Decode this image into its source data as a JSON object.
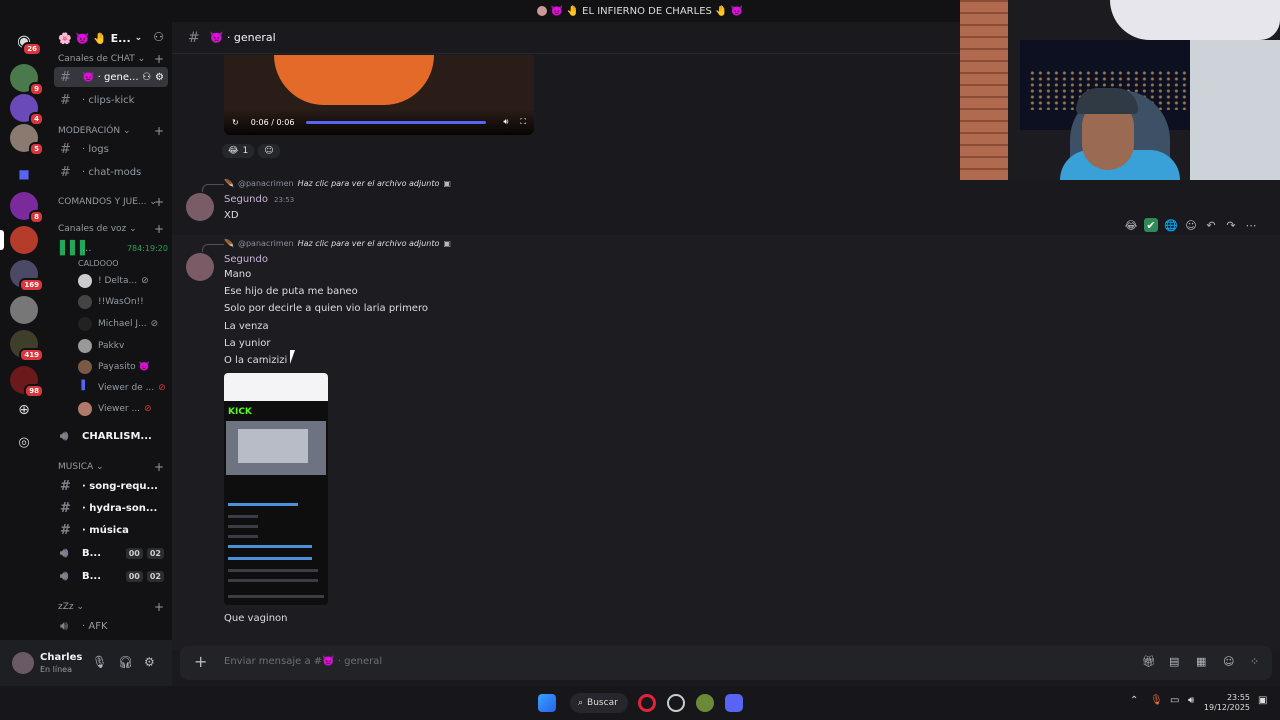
{
  "window": {
    "title": "👿 🤚 EL INFIERNO DE CHARLES 🤚 👿"
  },
  "servers": [
    {
      "badge": "26"
    },
    {
      "badge": "9"
    },
    {
      "badge": "4"
    },
    {
      "badge": "5"
    },
    {
      "badge": ""
    },
    {
      "badge": "8"
    },
    {
      "badge": ""
    },
    {
      "badge": "169"
    },
    {
      "badge": ""
    },
    {
      "badge": "419"
    },
    {
      "badge": "98"
    }
  ],
  "guild": {
    "name": "🌸 👿 🤚 E..."
  },
  "categories": {
    "chat": "Canales de CHAT",
    "mod": "MODERACIÓN",
    "cmds": "COMANDOS Y JUE...",
    "voice": "Canales de voz",
    "music": "MUSICA",
    "zzz": "zZz"
  },
  "channels": {
    "general": "👿 · gene...",
    "clips": "· clips-kick",
    "logs": "· logs",
    "chatmods": "· chat-mods",
    "voice_main": "...",
    "voice_main_time": "784:19:20",
    "charlism": "CHARLISM...",
    "song": "· song-requ...",
    "hydra": "· hydra-son...",
    "musica": "· música",
    "b1": "B...",
    "b2": "B...",
    "b1_a": "00",
    "b1_b": "02",
    "b2_a": "00",
    "b2_b": "02",
    "afk": "· AFK"
  },
  "voice_users": [
    "CALDOOO",
    "! Delta...",
    "!!WasOn!!",
    "Michael J...",
    "Pakkv",
    "Payasito 👿",
    "Viewer de ...",
    "Viewer ..."
  ],
  "user": {
    "name": "Charles",
    "status": "En línea"
  },
  "header": {
    "channel": "👿 · general"
  },
  "video": {
    "time": "0:06 / 0:06"
  },
  "reaction": {
    "count": "1"
  },
  "messages": [
    {
      "reply_user": "@panacrimen",
      "reply_text": "Haz clic para ver el archivo adjunto",
      "author": "Segundo",
      "time": "23:53",
      "lines": [
        "XD"
      ]
    },
    {
      "reply_user": "@panacrimen",
      "reply_text": "Haz clic para ver el archivo adjunto",
      "author": "Segundo",
      "lines": [
        "Mano",
        "Ese hijo de puta me baneo",
        "Solo por decirle a quien vio laria primero",
        "La venza",
        "La yunior",
        "O la camizizi"
      ],
      "after": "Que vaginon"
    }
  ],
  "composer": {
    "placeholder": "Enviar mensaje a #👿 · general"
  },
  "taskbar": {
    "search": "Buscar",
    "time": "23:55",
    "date": "19/12/2025"
  }
}
